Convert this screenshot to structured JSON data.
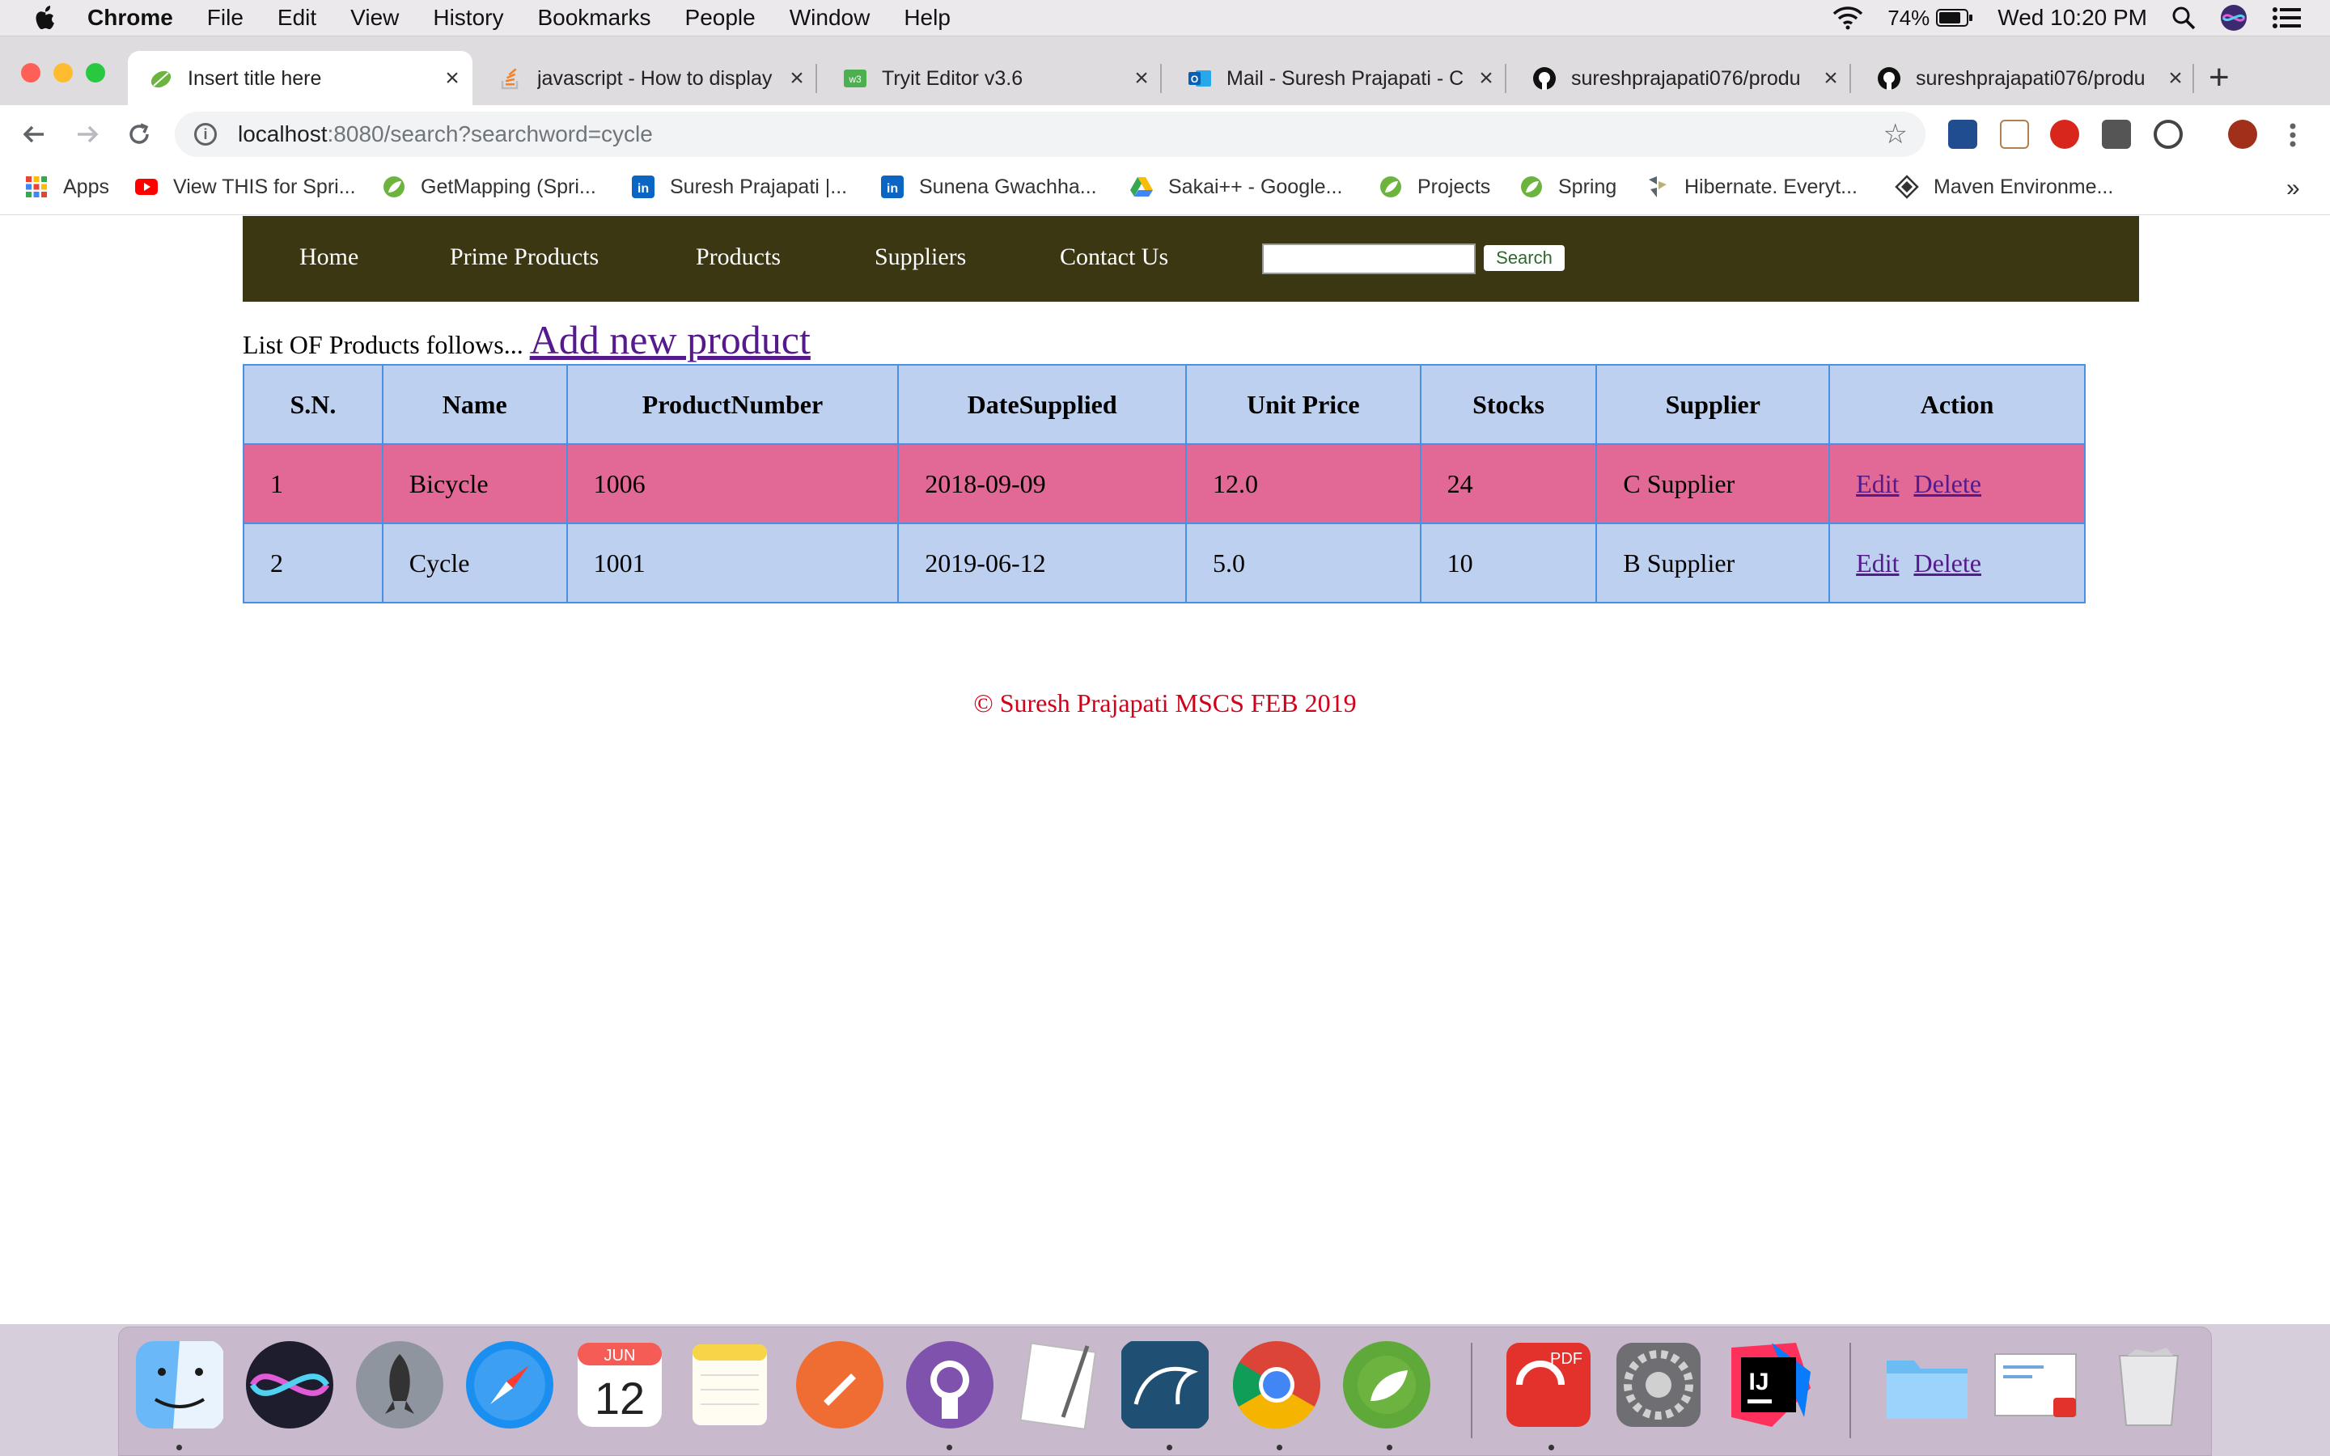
{
  "menubar": {
    "app_name": "Chrome",
    "items": [
      "File",
      "Edit",
      "View",
      "History",
      "Bookmarks",
      "People",
      "Window",
      "Help"
    ],
    "battery": "74%",
    "clock": "Wed 10:20 PM"
  },
  "tabs": [
    {
      "title": "Insert title here",
      "active": true
    },
    {
      "title": "javascript - How to display",
      "active": false
    },
    {
      "title": "Tryit Editor v3.6",
      "active": false
    },
    {
      "title": "Mail - Suresh Prajapati - C",
      "active": false
    },
    {
      "title": "sureshprajapati076/produ",
      "active": false
    },
    {
      "title": "sureshprajapati076/produ",
      "active": false
    }
  ],
  "omnibox": {
    "host": "localhost",
    "rest": ":8080/search?searchword=cycle"
  },
  "bookmarks": [
    {
      "label": "Apps"
    },
    {
      "label": "View THIS for Spri..."
    },
    {
      "label": "GetMapping (Spri..."
    },
    {
      "label": "Suresh Prajapati |..."
    },
    {
      "label": "Sunena Gwachha..."
    },
    {
      "label": "Sakai++ - Google..."
    },
    {
      "label": "Projects"
    },
    {
      "label": "Spring"
    },
    {
      "label": "Hibernate. Everyt..."
    },
    {
      "label": "Maven Environme..."
    }
  ],
  "bookmarks_overflow": "»",
  "site": {
    "nav": [
      "Home",
      "Prime Products",
      "Products",
      "Suppliers",
      "Contact Us"
    ],
    "search_value": "",
    "search_button": "Search",
    "list_label": "List OF Products follows...",
    "add_link": "Add new product",
    "columns": [
      "S.N.",
      "Name",
      "ProductNumber",
      "DateSupplied",
      "Unit Price",
      "Stocks",
      "Supplier",
      "Action"
    ],
    "rows": [
      {
        "sn": "1",
        "name": "Bicycle",
        "number": "1006",
        "date": "2018-09-09",
        "price": "12.0",
        "stocks": "24",
        "supplier": "C Supplier",
        "edit": "Edit",
        "delete": "Delete"
      },
      {
        "sn": "2",
        "name": "Cycle",
        "number": "1001",
        "date": "2019-06-12",
        "price": "5.0",
        "stocks": "10",
        "supplier": "B Supplier",
        "edit": "Edit",
        "delete": "Delete"
      }
    ],
    "footer": "© Suresh Prajapati MSCS FEB 2019"
  },
  "dock": {
    "calendar_month": "JUN",
    "calendar_day": "12",
    "pdf_label": "PDF",
    "ij_label": "IJ"
  },
  "colors": {
    "site_nav_bg": "#3a3712",
    "table_header_bg": "#bed0ef",
    "row_highlight": "#e26895",
    "link": "#551a8b",
    "footer": "#d0021b"
  }
}
